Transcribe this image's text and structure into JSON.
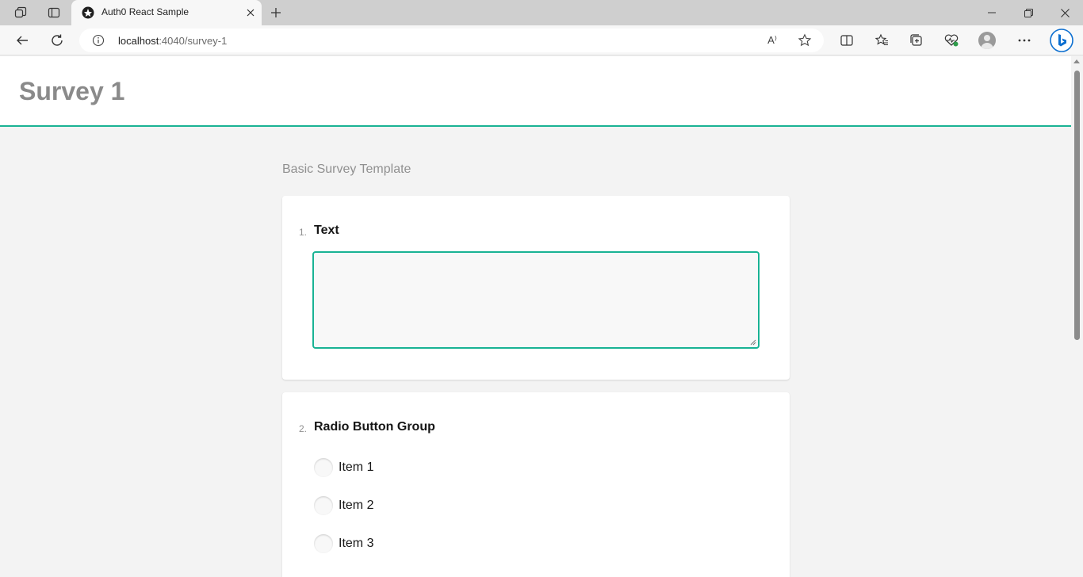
{
  "browser": {
    "tab": {
      "title": "Auth0 React Sample"
    },
    "address": {
      "host": "localhost",
      "port_path": ":4040/survey-1"
    },
    "icons": {
      "workspaces": "workspaces-icon",
      "tab_actions": "tab-actions-icon",
      "favicon": "auth0-favicon-icon",
      "close_tab": "close-icon",
      "new_tab": "plus-icon",
      "minimize": "minimize-icon",
      "restore": "restore-icon",
      "close_window": "close-icon",
      "back": "back-arrow-icon",
      "refresh": "refresh-icon",
      "site_info": "info-icon",
      "read_aloud": "read-aloud-icon",
      "favorite": "star-icon",
      "split_screen": "split-screen-icon",
      "favorites": "favorites-icon",
      "collections": "collections-icon",
      "browser_essentials": "heart-pulse-icon",
      "profile": "profile-avatar-icon",
      "more": "more-icon",
      "copilot": "bing-icon"
    },
    "read_aloud_label": "A⁾"
  },
  "page": {
    "title": "Survey 1",
    "description": "Basic Survey Template",
    "accent_color": "#19b394"
  },
  "questions": [
    {
      "number": "1.",
      "title": "Text",
      "type": "comment",
      "value": ""
    },
    {
      "number": "2.",
      "title": "Radio Button Group",
      "type": "radiogroup",
      "choices": [
        "Item 1",
        "Item 2",
        "Item 3"
      ]
    }
  ]
}
